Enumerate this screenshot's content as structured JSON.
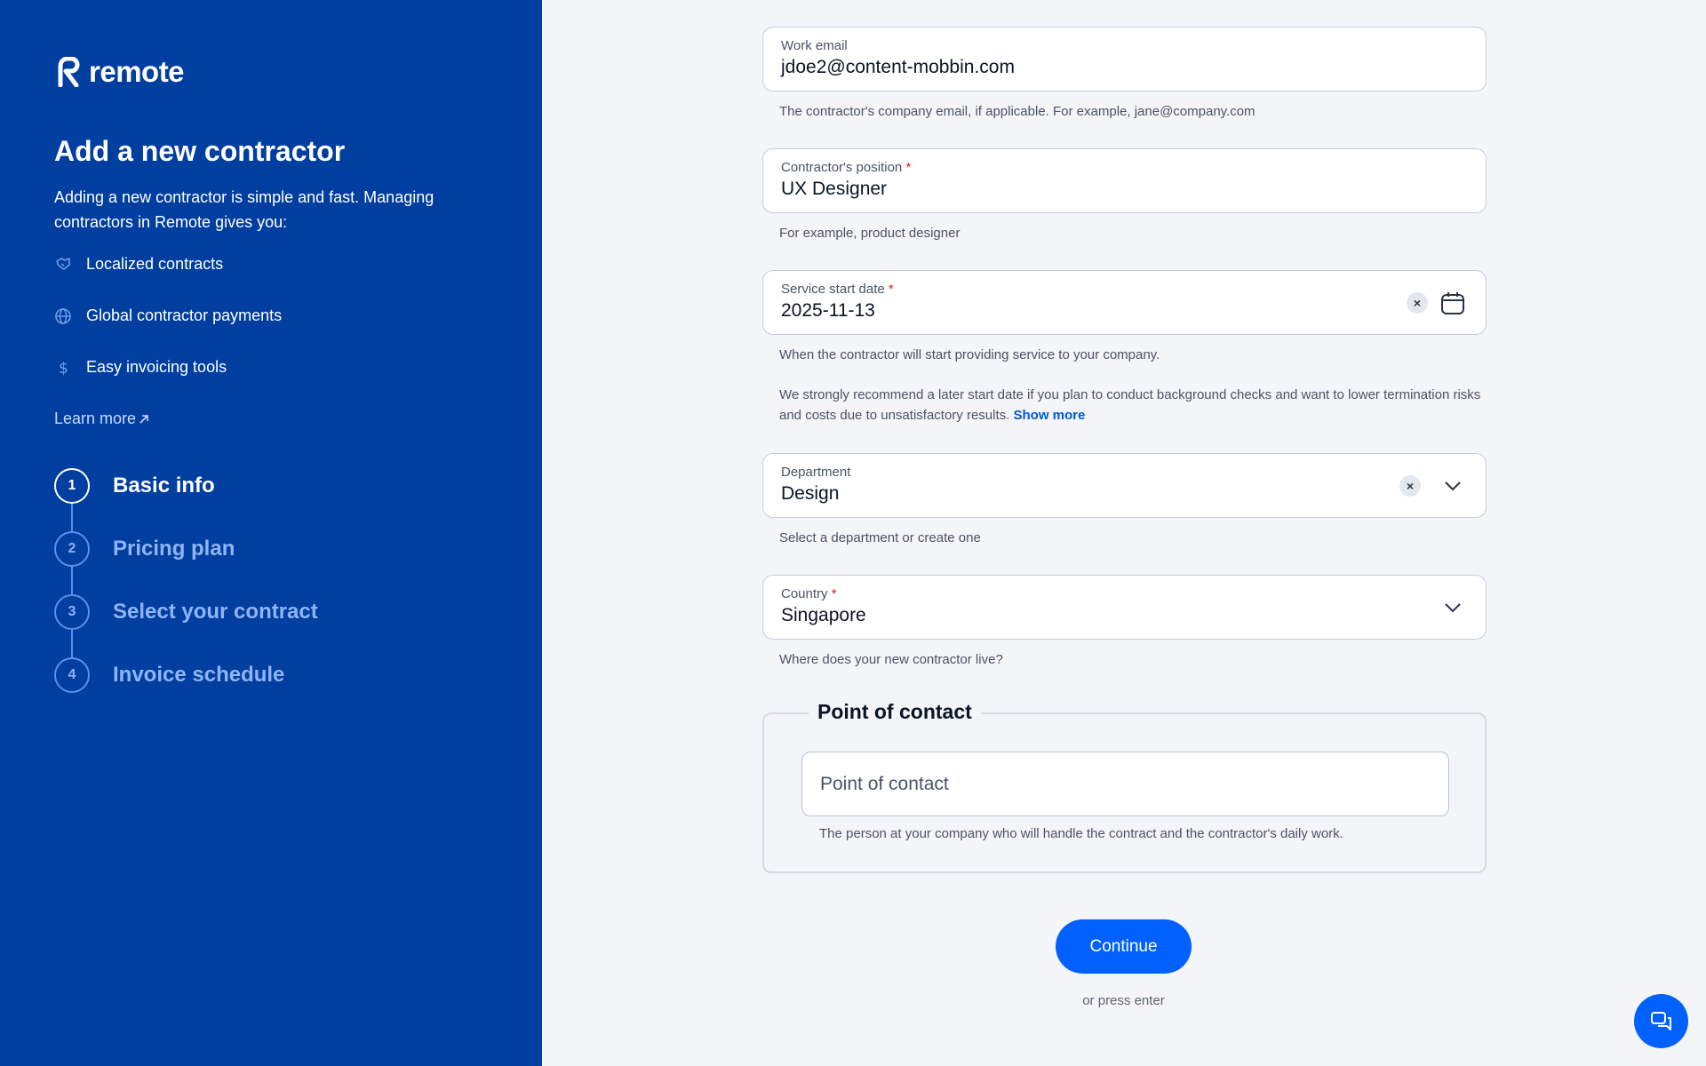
{
  "sidebar": {
    "logo_text": "remote",
    "title": "Add a new contractor",
    "description": "Adding a new contractor is simple and fast. Managing contractors in Remote gives you:",
    "benefits": [
      {
        "label": "Localized contracts",
        "icon": "handshake-icon"
      },
      {
        "label": "Global contractor payments",
        "icon": "globe-icon"
      },
      {
        "label": "Easy invoicing tools",
        "icon": "dollar-icon"
      }
    ],
    "learn_more": "Learn more",
    "steps": [
      {
        "num": "1",
        "label": "Basic info"
      },
      {
        "num": "2",
        "label": "Pricing plan"
      },
      {
        "num": "3",
        "label": "Select your contract"
      },
      {
        "num": "4",
        "label": "Invoice schedule"
      }
    ]
  },
  "form": {
    "work_email": {
      "label": "Work email",
      "value": "jdoe2@content-mobbin.com",
      "help": "The contractor's company email, if applicable. For example, jane@company.com"
    },
    "position": {
      "label": "Contractor's position",
      "required": "*",
      "value": "UX Designer",
      "help": "For example, product designer"
    },
    "start_date": {
      "label": "Service start date",
      "required": "*",
      "value": "2025-11-13",
      "help": "When the contractor will start providing service to your company.",
      "help2": "We strongly recommend a later start date if you plan to conduct background checks and want to lower termination risks and costs due to unsatisfactory results.",
      "show_more": "Show more"
    },
    "department": {
      "label": "Department",
      "value": "Design",
      "help": "Select a department or create one"
    },
    "country": {
      "label": "Country",
      "required": "*",
      "value": "Singapore",
      "help": "Where does your new contractor live?"
    },
    "point_of_contact": {
      "legend": "Point of contact",
      "placeholder": "Point of contact",
      "help": "The person at your company who will handle the contract and the contractor's daily work."
    }
  },
  "actions": {
    "continue": "Continue",
    "press_enter": "or press enter"
  },
  "colors": {
    "sidebar_bg": "#003e9f",
    "primary": "#0061ff",
    "required": "#d8232a"
  }
}
